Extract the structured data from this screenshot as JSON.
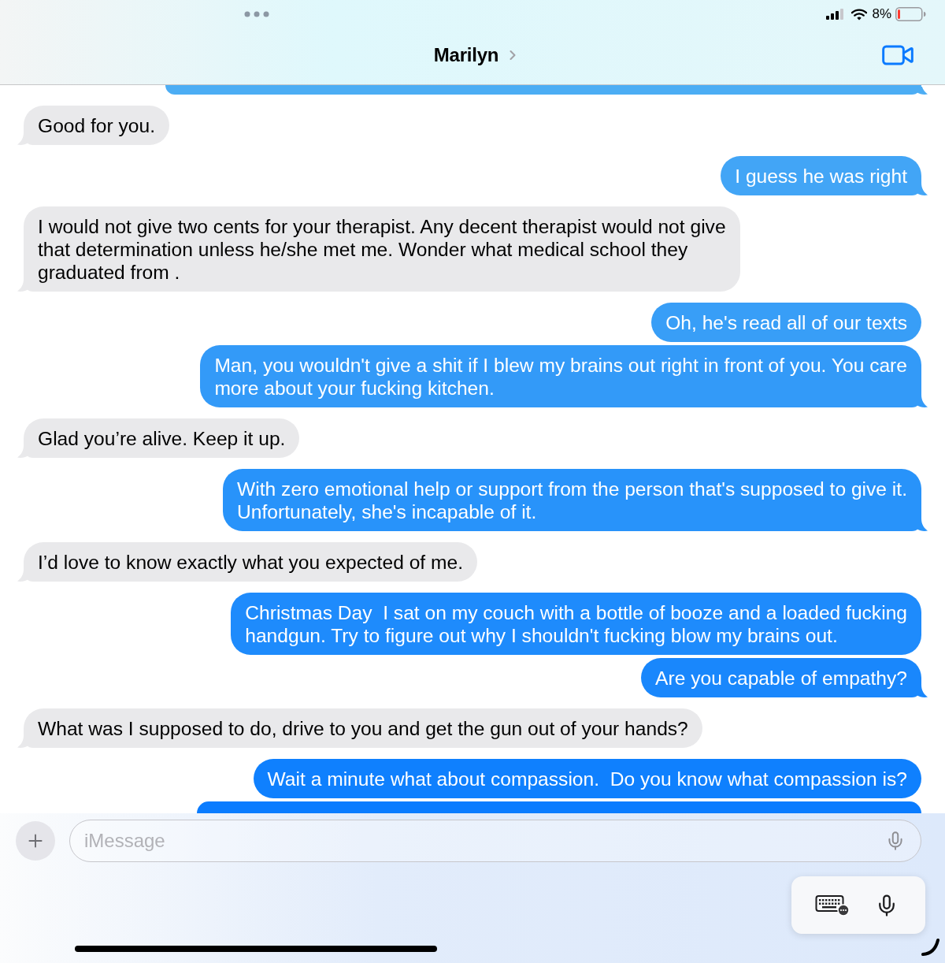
{
  "status_bar": {
    "battery_percent": "8%"
  },
  "header": {
    "contact_name": "Marilyn"
  },
  "messages": [
    {
      "kind": "sent",
      "tail": true,
      "clipped": true
    },
    {
      "kind": "received",
      "tail": true,
      "text": "Good for you."
    },
    {
      "kind": "sent",
      "tail": true,
      "text": "I guess he was right"
    },
    {
      "kind": "received",
      "tail": true,
      "text": "I would not give two cents for your therapist. Any decent therapist would not give\nthat determination unless he/she met me. Wonder what medical school they\ngraduated from ."
    },
    {
      "kind": "sent",
      "tail": false,
      "text": "Oh, he's read all of our texts"
    },
    {
      "kind": "sent",
      "tail": true,
      "text": "Man, you wouldn't give a shit if I blew my brains out right in front of you. You care\nmore about your fucking kitchen."
    },
    {
      "kind": "received",
      "tail": true,
      "text": "Glad you’re alive. Keep it up."
    },
    {
      "kind": "sent",
      "tail": true,
      "text": "With zero emotional help or support from the person that's supposed to give it.\nUnfortunately, she's incapable of it."
    },
    {
      "kind": "received",
      "tail": true,
      "text": "I’d love to know exactly what you expected of me."
    },
    {
      "kind": "sent",
      "tail": false,
      "text": "Christmas Day  I sat on my couch with a bottle of booze and a loaded fucking\nhandgun. Try to figure out why I shouldn't fucking blow my brains out."
    },
    {
      "kind": "sent",
      "tail": true,
      "text": "Are you capable of empathy?"
    },
    {
      "kind": "received",
      "tail": true,
      "text": "What was I supposed to do, drive to you and get the gun out of your hands?"
    },
    {
      "kind": "sent",
      "tail": false,
      "text": "Wait a minute what about compassion.  Do you know what compassion is?"
    },
    {
      "kind": "sent",
      "tail": false,
      "clipped": true
    }
  ],
  "composer": {
    "placeholder": "iMessage"
  }
}
